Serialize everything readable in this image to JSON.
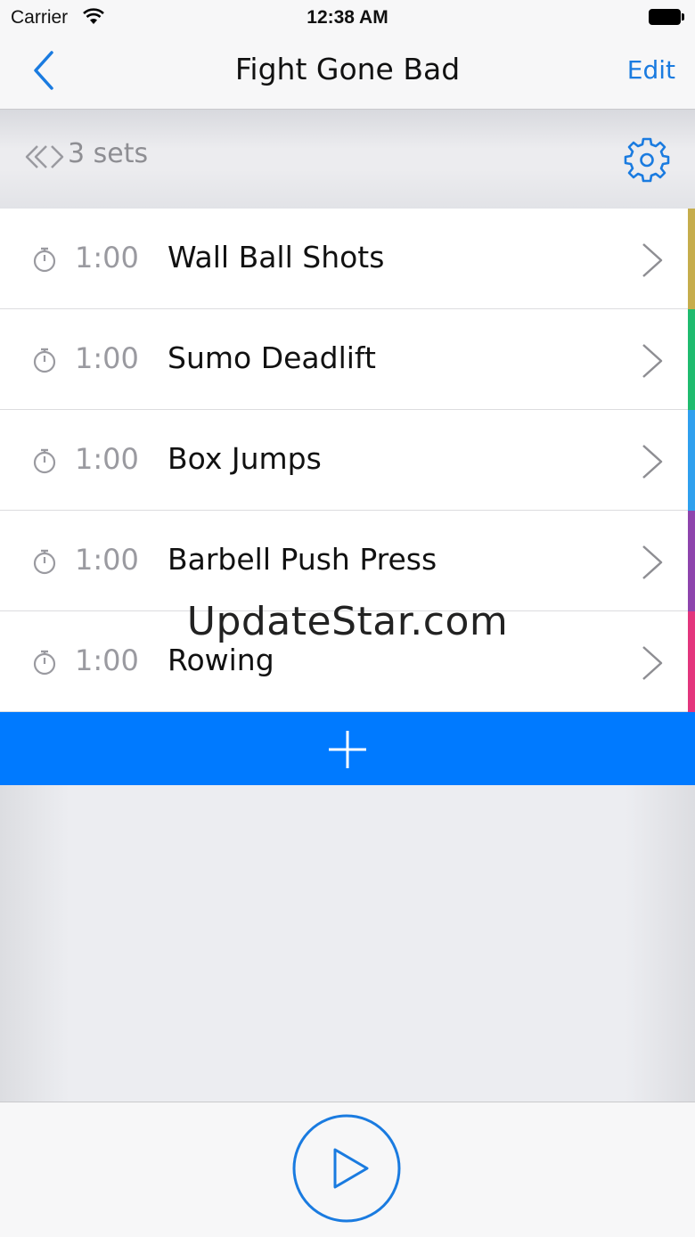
{
  "status_bar": {
    "carrier": "Carrier",
    "time": "12:38 AM"
  },
  "nav": {
    "title": "Fight Gone Bad",
    "edit_label": "Edit"
  },
  "sets": {
    "label": "3 sets"
  },
  "exercises": [
    {
      "duration": "1:00",
      "name": "Wall Ball Shots",
      "color": "#c6ad4c"
    },
    {
      "duration": "1:00",
      "name": "Sumo Deadlift",
      "color": "#1fbb6f"
    },
    {
      "duration": "1:00",
      "name": "Box Jumps",
      "color": "#2fa0ee"
    },
    {
      "duration": "1:00",
      "name": "Barbell Push Press",
      "color": "#8e44ad"
    },
    {
      "duration": "1:00",
      "name": "Rowing",
      "color": "#e3357d"
    }
  ],
  "watermark": "UpdateStar.com",
  "colors": {
    "accent": "#007aff",
    "link": "#1a7be0"
  }
}
